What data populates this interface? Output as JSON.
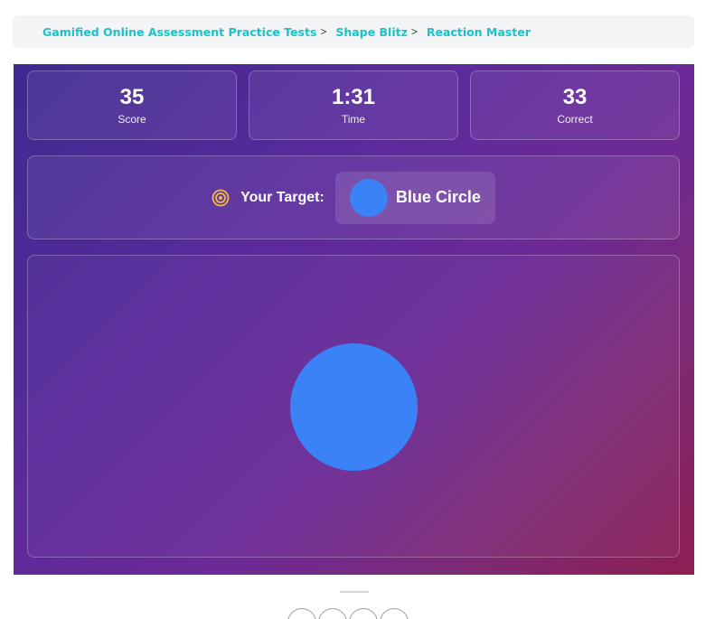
{
  "breadcrumb": {
    "items": [
      {
        "label": "Gamified Online Assessment Practice Tests"
      },
      {
        "label": "Shape Blitz"
      },
      {
        "label": "Reaction Master"
      }
    ],
    "separator": ">"
  },
  "stats": {
    "score": {
      "value": "35",
      "label": "Score"
    },
    "time": {
      "value": "1:31",
      "label": "Time"
    },
    "correct": {
      "value": "33",
      "label": "Correct"
    }
  },
  "target": {
    "prompt": "Your Target:",
    "shape_label": "Blue Circle",
    "shape_color": "#3b82f6",
    "icon": "target-icon"
  },
  "play_area": {
    "shape": {
      "type": "circle",
      "color": "#3b82f6"
    }
  },
  "colors": {
    "accent_link": "#1cc1c9",
    "gradient_start": "#3d2a8f",
    "gradient_end": "#8e1f52"
  },
  "share": {
    "icons": [
      "facebook-icon",
      "twitter-icon",
      "linkedin-icon",
      "pinterest-icon"
    ]
  }
}
